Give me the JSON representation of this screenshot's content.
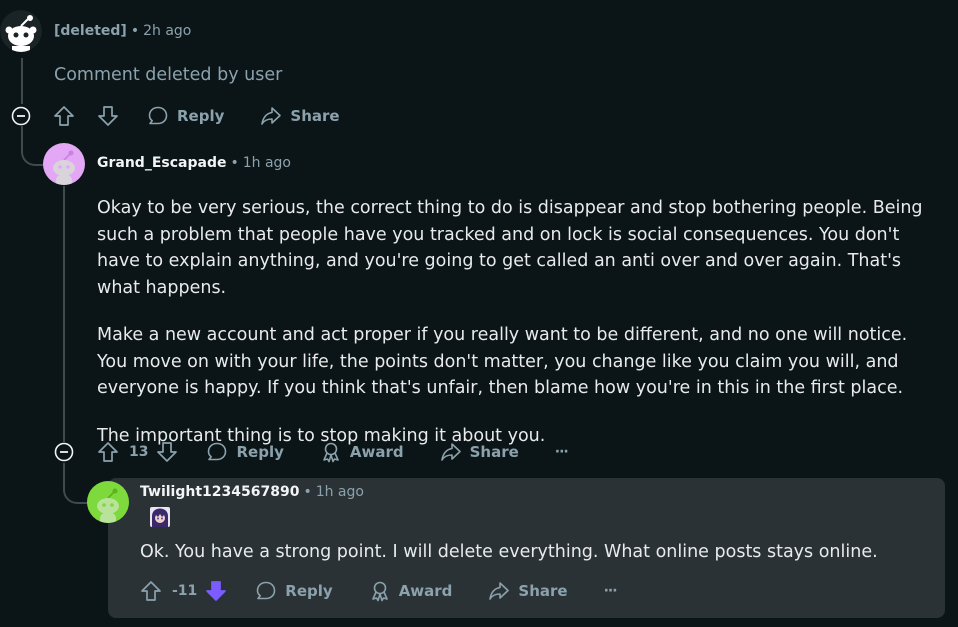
{
  "comments": {
    "deleted": {
      "author": "[deleted]",
      "time": "2h ago",
      "body": "Comment deleted by user",
      "actions": {
        "reply": "Reply",
        "share": "Share"
      }
    },
    "grand": {
      "author": "Grand_Escapade",
      "time": "1h ago",
      "paragraphs": [
        "Okay to be very serious, the correct thing to do is disappear and stop bothering people. Being such a problem that people have you tracked and on lock is social consequences. You don't have to explain anything, and you're going to get called an anti over and over again. That's what happens.",
        "Make a new account and act proper if you really want to be different, and no one will notice. You move on with your life, the points don't matter, you change like you claim you will, and everyone is happy. If you think that's unfair, then blame how you're in this in the first place.",
        "The important thing is to stop making it about you."
      ],
      "score": "13",
      "actions": {
        "reply": "Reply",
        "award": "Award",
        "share": "Share",
        "more": "···"
      }
    },
    "twilight": {
      "author": "Twilight1234567890",
      "time": "1h ago",
      "body": "Ok. You have a strong point. I will delete everything. What online posts stays online.",
      "score": "-11",
      "downvoted": true,
      "actions": {
        "reply": "Reply",
        "award": "Award",
        "share": "Share",
        "more": "···"
      }
    }
  },
  "colors": {
    "background": "#0b1416",
    "highlight": "#2a3236",
    "muted": "#8ba2ad",
    "downvote": "#7a5cff",
    "grand_avatar": "#e3a7f5",
    "twilight_avatar": "#7dd93c"
  },
  "icons": [
    "reddit-snoo-icon",
    "upvote-icon",
    "downvote-icon",
    "reply-icon",
    "share-icon",
    "award-icon",
    "collapse-icon",
    "more-icon"
  ]
}
